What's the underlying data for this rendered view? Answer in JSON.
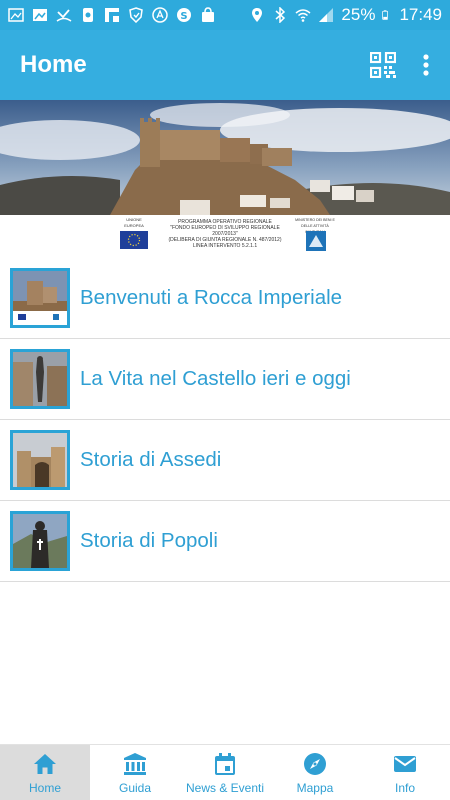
{
  "status_bar": {
    "battery": "25%",
    "time": "17:49"
  },
  "app_bar": {
    "title": "Home",
    "qr_icon": "qr-code-icon",
    "menu_icon": "more-vert-icon"
  },
  "banner": {
    "caption_center": "PROGRAMMA OPERATIVO REGIONALE\n\"FONDO EUROPEO DI SVILUPPO REGIONALE 2007/2013\"\n(DELIBERA DI GIUNTA REGIONALE N. 487/2012)\nLINEA INTERVENTO 5.2.1.1",
    "caption_left": "UNIONE EUROPEA",
    "caption_right": "MINISTERO DEI BENI E DELLE ATTIVITÀ CULTURALI"
  },
  "list": {
    "items": [
      {
        "label": "Benvenuti a Rocca Imperiale"
      },
      {
        "label": "La Vita nel Castello ieri e oggi"
      },
      {
        "label": "Storia di Assedi"
      },
      {
        "label": "Storia di Popoli"
      }
    ]
  },
  "bottom_nav": {
    "items": [
      {
        "label": "Home",
        "icon": "home-icon",
        "active": true
      },
      {
        "label": "Guida",
        "icon": "museum-icon",
        "active": false
      },
      {
        "label": "News & Eventi",
        "icon": "calendar-icon",
        "active": false
      },
      {
        "label": "Mappa",
        "icon": "compass-icon",
        "active": false
      },
      {
        "label": "Info",
        "icon": "mail-icon",
        "active": false
      }
    ]
  },
  "colors": {
    "primary": "#35aee0",
    "accent_text": "#2f9fd3",
    "active_nav_bg": "#dcdcdc"
  }
}
